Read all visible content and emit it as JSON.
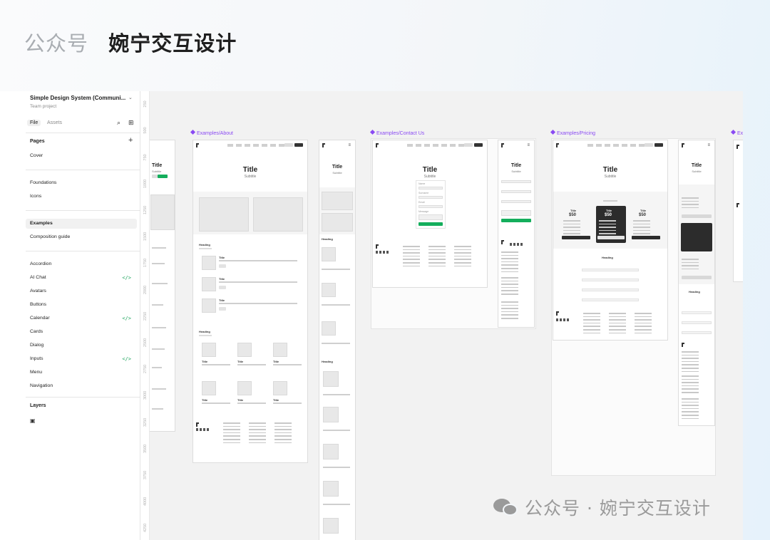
{
  "brand": {
    "account_prefix": "公众号",
    "account_name": "婉宁交互设计"
  },
  "sidebar": {
    "file_name": "Simple Design System (Communi...",
    "team": "Team project",
    "tabs": [
      "File",
      "Assets"
    ],
    "pages_label": "Pages",
    "pages": [
      "Cover",
      "Foundations",
      "Icons",
      "Examples",
      "Composition guide",
      "Accordion",
      "AI Chat",
      "Avatars",
      "Buttons",
      "Calendar",
      "Cards",
      "Dialog",
      "Inputs",
      "Menu",
      "Navigation"
    ],
    "selected_page": "Examples",
    "code_badge": "</>",
    "layers_label": "Layers"
  },
  "ruler": [
    "250",
    "500",
    "750",
    "1000",
    "1250",
    "1500",
    "1750",
    "2000",
    "2250",
    "2500",
    "2750",
    "3000",
    "3250",
    "3500",
    "3750",
    "4000",
    "4250"
  ],
  "frames": [
    {
      "label": "Examples/About",
      "title": "Title",
      "subtitle": "Subtitle",
      "heading": "Heading",
      "card_title": "Title",
      "button": "Button"
    },
    {
      "label": "Examples/Contact Us",
      "title": "Title",
      "subtitle": "Subtitle",
      "form_labels": [
        "Name",
        "Surname",
        "Email",
        "Message"
      ],
      "button": "Submit"
    },
    {
      "label": "Examples/Pricing",
      "title": "Title",
      "subtitle": "Subtitle",
      "price": "$50",
      "heading": "Heading"
    },
    {
      "label": "Ex"
    }
  ],
  "watermark": {
    "text": "公众号 · 婉宁交互设计"
  },
  "colors": {
    "frame_label": "#8a4af3",
    "code_badge": "#1aa35a",
    "accent_button": "#14ae5c"
  }
}
